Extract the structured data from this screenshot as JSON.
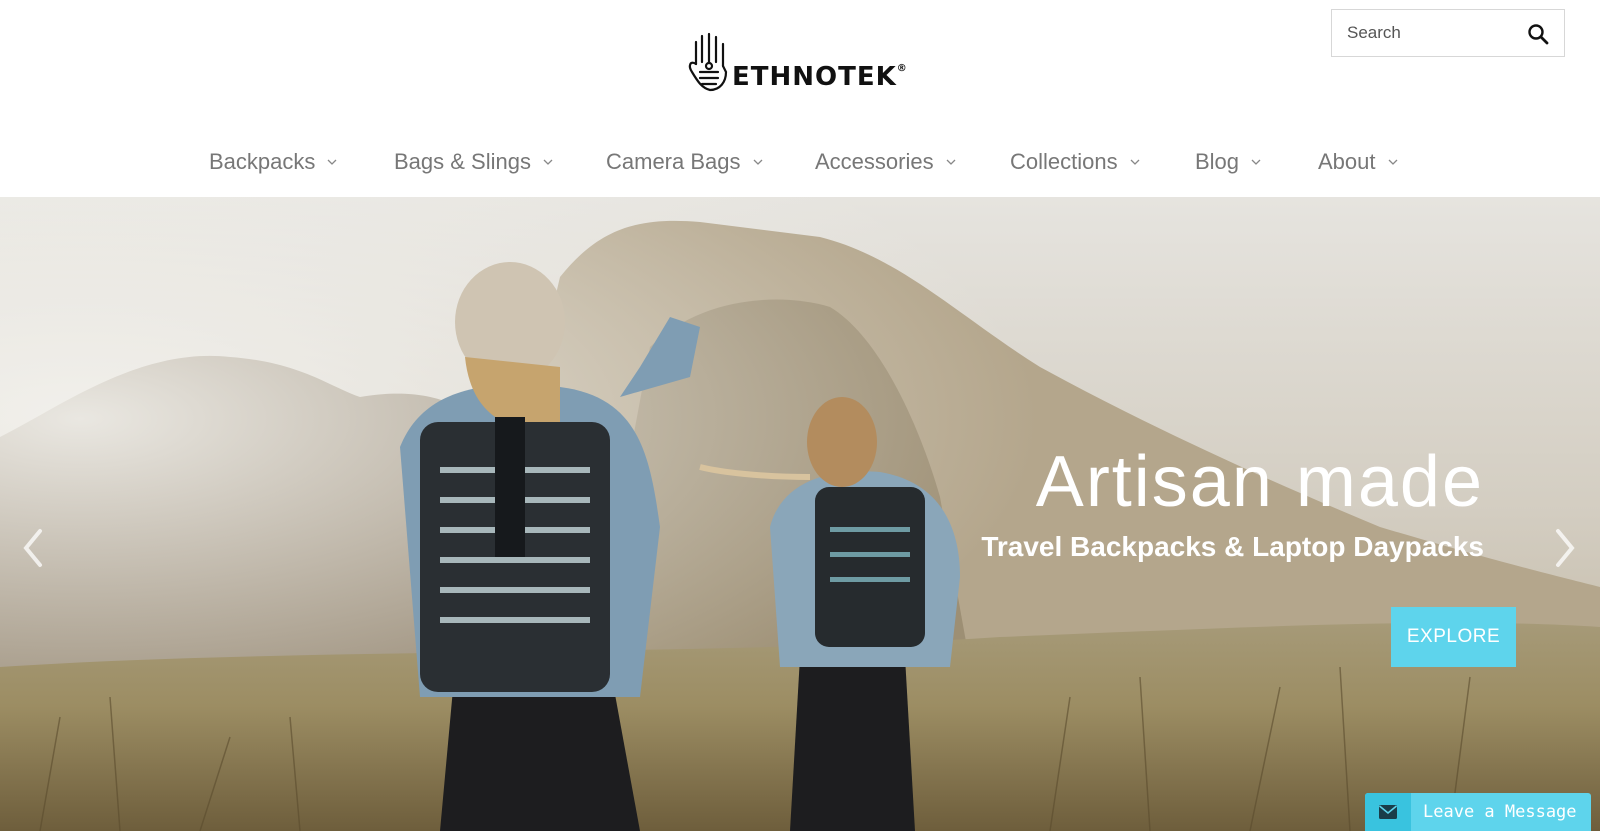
{
  "brand": {
    "logo_text": "ETHNOTEK",
    "logo_mark": "®"
  },
  "search": {
    "placeholder": "Search"
  },
  "nav": {
    "items": [
      {
        "label": "Backpacks"
      },
      {
        "label": "Bags & Slings"
      },
      {
        "label": "Camera Bags"
      },
      {
        "label": "Accessories"
      },
      {
        "label": "Collections"
      },
      {
        "label": "Blog"
      },
      {
        "label": "About"
      }
    ]
  },
  "hero": {
    "title": "Artisan made",
    "subtitle": "Travel Backpacks & Laptop Daypacks",
    "cta_label": "EXPLORE"
  },
  "chat": {
    "label": "Leave a Message"
  },
  "colors": {
    "accent": "#5ed4ec",
    "nav_text": "#777777"
  }
}
